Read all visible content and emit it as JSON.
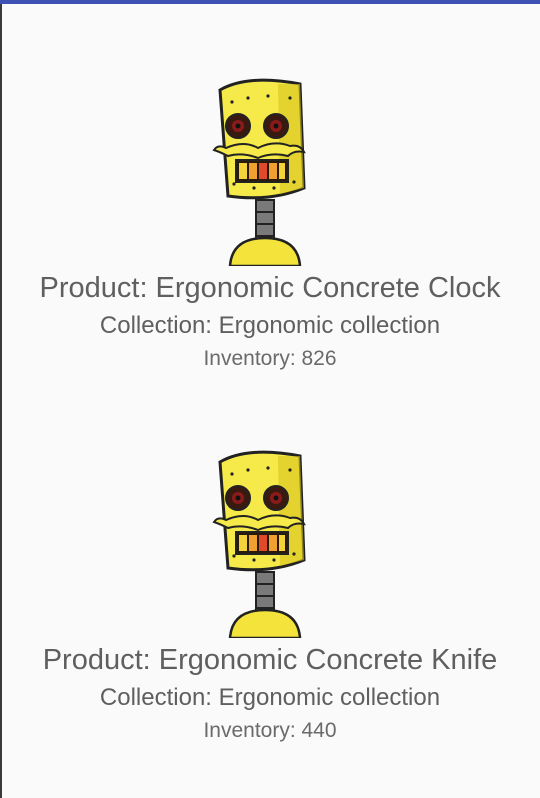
{
  "colors": {
    "accent": "#3f51b5",
    "text": "#5f5f5f",
    "background": "#fafafa"
  },
  "products": [
    {
      "title": "Product: Ergonomic Concrete Clock",
      "collection": "Collection: Ergonomic collection",
      "inventory": "Inventory: 826",
      "image_icon": "robot-product-image"
    },
    {
      "title": "Product: Ergonomic Concrete Knife",
      "collection": "Collection: Ergonomic collection",
      "inventory": "Inventory: 440",
      "image_icon": "robot-product-image"
    }
  ]
}
